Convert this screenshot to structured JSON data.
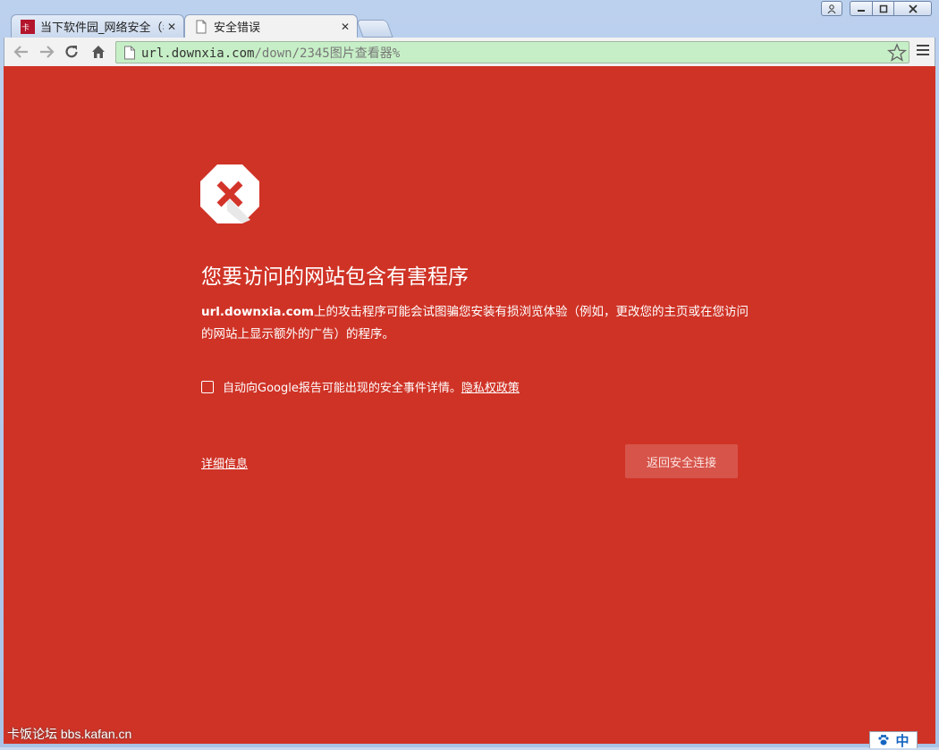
{
  "window": {
    "controls": {
      "user_icon": "user-icon",
      "minimize": "minimize-icon",
      "maximize": "maximize-icon",
      "close": "close-icon"
    }
  },
  "tabs": [
    {
      "title": "当下软件园_网络安全（毒",
      "active": false,
      "favicon": "downxia-favicon"
    },
    {
      "title": "安全错误",
      "active": true,
      "favicon": "page-icon"
    }
  ],
  "toolbar": {
    "back_icon": "back-arrow-icon",
    "forward_icon": "forward-arrow-icon",
    "reload_icon": "reload-icon",
    "home_icon": "home-icon",
    "url_host": "url.downxia.com",
    "url_path": "/down/2345图片查看器%",
    "star_icon": "star-icon",
    "menu_icon": "menu-icon"
  },
  "page": {
    "icon": "error-x-octagon-icon",
    "heading": "您要访问的网站包含有害程序",
    "desc_site": "url.downxia.com",
    "desc_rest": "上的攻击程序可能会试图骗您安装有损浏览体验（例如，更改您的主页或在您访问的网站上显示额外的广告）的程序。",
    "report_text": "自动向Google报告可能出现的安全事件详情。",
    "privacy_link": "隐私权政策",
    "details_link": "详细信息",
    "back_button": "返回安全连接"
  },
  "overlay": {
    "watermark": "卡饭论坛 bbs.kafan.cn",
    "ime_label": "中"
  },
  "colors": {
    "page_bg": "#cf3326",
    "omnibox_bg": "#c7efc7",
    "button_bg": "#d7544a"
  }
}
